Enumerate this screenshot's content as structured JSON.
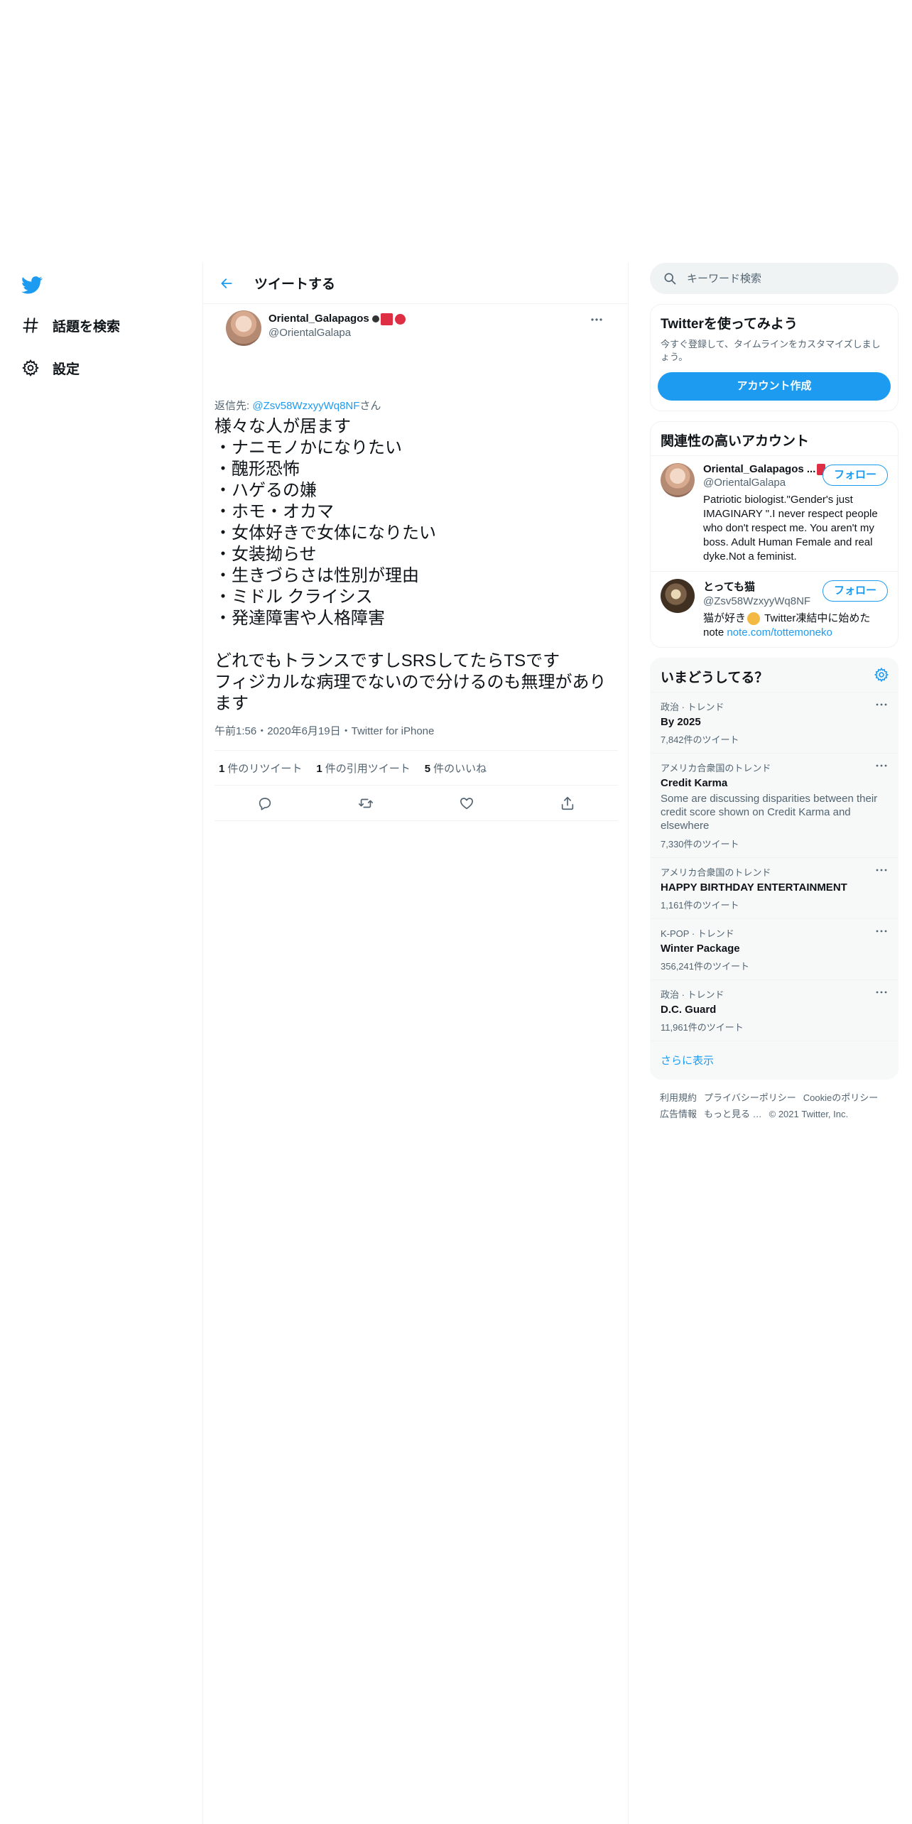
{
  "nav": {
    "logo": "twitter-bird-icon",
    "items": [
      {
        "label": "話題を検索",
        "icon": "hashtag-icon"
      },
      {
        "label": "設定",
        "icon": "gear-icon"
      }
    ]
  },
  "main": {
    "title": "ツイートする",
    "tweet": {
      "name": "Oriental_Galapagos",
      "handle": "@OrientalGalapa",
      "reply_prefix": "返信先: ",
      "reply_mention": "@Zsv58WzxyyWq8NF",
      "reply_suffix": "さん",
      "body": "様々な人が居ます\n・ナニモノかになりたい\n・醜形恐怖\n・ハゲるの嫌\n・ホモ・オカマ\n・女体好きで女体になりたい\n・女装拗らせ\n・生きづらさは性別が理由\n・ミドル クライシス\n・発達障害や人格障害\n\nどれでもトランスですしSRSしてたらTSです\nフィジカルな病理でないので分けるのも無理があります",
      "time": "午前1:56",
      "date": "2020年6月19日",
      "sep": "・",
      "source": "Twitter for iPhone",
      "stats": [
        {
          "count": "1",
          "label": "件のリツイート"
        },
        {
          "count": "1",
          "label": "件の引用ツイート"
        },
        {
          "count": "5",
          "label": "件のいいね"
        }
      ]
    }
  },
  "side": {
    "search_placeholder": "キーワード検索",
    "signup": {
      "title": "Twitterを使ってみよう",
      "text": "今すぐ登録して、タイムラインをカスタマイズしましょう。",
      "button": "アカウント作成"
    },
    "related": {
      "title": "関連性の高いアカウント",
      "users": [
        {
          "name": "Oriental_Galapagos ...",
          "handle": "@OrientalGalapa",
          "bio": "Patriotic biologist.\"Gender's just IMAGINARY \".I never respect people who don't respect me. You aren't my boss. Adult Human Female and real dyke.Not a feminist.",
          "follow": "フォロー"
        },
        {
          "name": "とっても猫",
          "handle": "@Zsv58WzxyyWq8NF",
          "bio_prefix": "猫が好き",
          "bio_mid": " Twitter凍結中に始めたnote ",
          "bio_link": "note.com/tottemoneko",
          "follow": "フォロー"
        }
      ]
    },
    "trends": {
      "title": "いまどうしてる？",
      "items": [
        {
          "context": "政治 · トレンド",
          "name": "By 2025",
          "desc": "",
          "count": "7,842件のツイート"
        },
        {
          "context": "アメリカ合衆国のトレンド",
          "name": "Credit Karma",
          "desc": "Some are discussing disparities between their credit score shown on Credit Karma and elsewhere",
          "count": "7,330件のツイート"
        },
        {
          "context": "アメリカ合衆国のトレンド",
          "name": "HAPPY BIRTHDAY ENTERTAINMENT",
          "desc": "",
          "count": "1,161件のツイート"
        },
        {
          "context": "K-POP · トレンド",
          "name": "Winter Package",
          "desc": "",
          "count": "356,241件のツイート"
        },
        {
          "context": "政治 · トレンド",
          "name": "D.C. Guard",
          "desc": "",
          "count": "11,961件のツイート"
        }
      ],
      "show_more": "さらに表示"
    },
    "footer": {
      "links": [
        "利用規約",
        "プライバシーポリシー",
        "Cookieのポリシー",
        "広告情報",
        "もっと見る …"
      ],
      "copyright": "© 2021 Twitter, Inc."
    }
  },
  "colors": {
    "accent": "#1d9bf0",
    "text": "#0f1419",
    "muted": "#536471",
    "border": "#eff3f4"
  }
}
